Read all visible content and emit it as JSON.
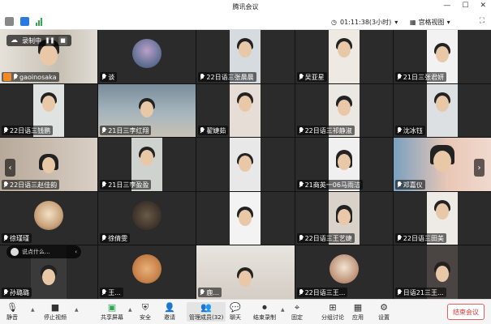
{
  "window": {
    "title": "腾讯会议"
  },
  "infobar": {
    "timer": "01:11:38(3小时)",
    "view_label": "宫格视图"
  },
  "recording": {
    "label": "录制中"
  },
  "chat_preview": {
    "text": "说点什么..."
  },
  "participants": [
    {
      "name": "gaoinosaka",
      "host": true
    },
    {
      "name": "谈"
    },
    {
      "name": "22日语三张晨晨"
    },
    {
      "name": "吴亚星"
    },
    {
      "name": "21日三张君妍"
    },
    {
      "name": "22日语三钱鹏"
    },
    {
      "name": "21日三李红翔"
    },
    {
      "name": "翟婕茹"
    },
    {
      "name": "22日语三祁静淑"
    },
    {
      "name": "沈冰钰"
    },
    {
      "name": "22日语三赵佳韵"
    },
    {
      "name": "21日三李盈盈"
    },
    {
      "name": ""
    },
    {
      "name": "21商英一06马雨洁"
    },
    {
      "name": "邓嘉仪"
    },
    {
      "name": "徐瑾瑾"
    },
    {
      "name": "徐倩雯"
    },
    {
      "name": ""
    },
    {
      "name": "22日语三王艺婕"
    },
    {
      "name": "22日语三田美"
    },
    {
      "name": "孙璐璐"
    },
    {
      "name": "王..."
    },
    {
      "name": "鹿..."
    },
    {
      "name": "22日语三王..."
    },
    {
      "name": "日语21三王..."
    }
  ],
  "toolbar": {
    "items": [
      "静音",
      "停止视频",
      "共享屏幕",
      "安全",
      "邀请",
      "管理成员(32)",
      "聊天",
      "结束录制",
      "分组讨论",
      "应用",
      "设置"
    ],
    "pin": "固定",
    "end_label": "结束会议"
  }
}
